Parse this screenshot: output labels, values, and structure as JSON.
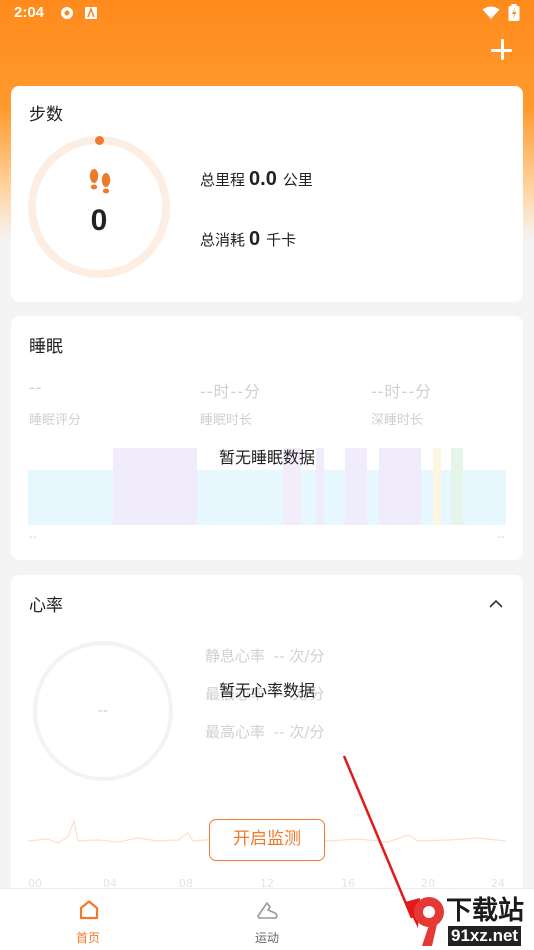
{
  "status_bar": {
    "time": "2:04"
  },
  "steps": {
    "title": "步数",
    "count": "0",
    "distance_label": "总里程",
    "distance_value": "0.0",
    "distance_unit": "公里",
    "calories_label": "总消耗",
    "calories_value": "0",
    "calories_unit": "千卡"
  },
  "sleep": {
    "title": "睡眠",
    "score_value": "--",
    "score_label": "睡眠评分",
    "duration_value": "--时--分",
    "duration_label": "睡眠时长",
    "deep_value": "--时--分",
    "deep_label": "深睡时长",
    "axis_left": "--",
    "axis_right": "--",
    "empty_text": "暂无睡眠数据"
  },
  "heart": {
    "title": "心率",
    "center_value": "--",
    "resting_label": "静息心率",
    "resting_value": "-- 次/分",
    "min_label": "最低心率",
    "min_value": "-- 次/分",
    "max_label": "最高心率",
    "max_value": "-- 次/分",
    "empty_text": "暂无心率数据",
    "monitor_button": "开启监测",
    "time_ticks": [
      "00",
      "04",
      "08",
      "12",
      "16",
      "20",
      "24"
    ]
  },
  "tabbar": {
    "items": [
      {
        "label": "首页",
        "icon": "home-icon",
        "active": true
      },
      {
        "label": "运动",
        "icon": "shoe-icon",
        "active": false
      }
    ]
  },
  "watermark": {
    "text": "下载站",
    "url_text": "91xz.net"
  },
  "colors": {
    "accent": "#f07a2c",
    "header": "#ff8a1c"
  }
}
